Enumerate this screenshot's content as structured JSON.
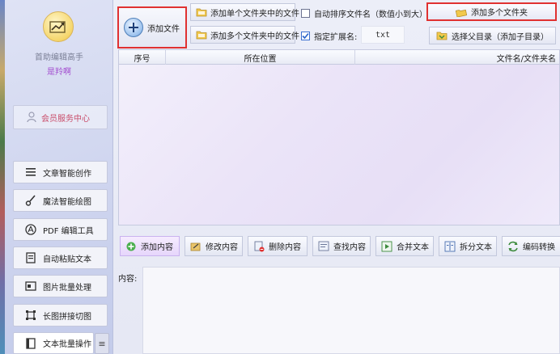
{
  "sidebar": {
    "app_name": "首助编辑高手",
    "user_name": "是羚啊",
    "member_center": "会员服务中心",
    "items": [
      {
        "label": "文章智能创作"
      },
      {
        "label": "魔法智能绘图"
      },
      {
        "label": "PDF 编辑工具"
      },
      {
        "label": "自动粘贴文本"
      },
      {
        "label": "图片批量处理"
      },
      {
        "label": "长图拼接切图"
      },
      {
        "label": "文本批量操作"
      }
    ],
    "more_label": "≡"
  },
  "toolbar": {
    "add_file": "添加文件",
    "add_single_folder_files": "添加单个文件夹中的文件",
    "add_multi_folder_files": "添加多个文件夹中的文件",
    "auto_sort_label": "自动排序文件名（数值小到大）",
    "auto_sort_checked": false,
    "ext_label": "指定扩展名:",
    "ext_checked": true,
    "ext_value": "txt",
    "add_multi_folders": "添加多个文件夹",
    "select_parent": "选择父目录（添加子目录）"
  },
  "table": {
    "columns": [
      "序号",
      "所在位置",
      "文件名/文件夹名"
    ]
  },
  "actions": {
    "add_content": "添加内容",
    "modify_content": "修改内容",
    "delete_content": "删除内容",
    "find_content": "查找内容",
    "merge_text": "合并文本",
    "split_text": "拆分文本",
    "encode_convert": "编码转换"
  },
  "content": {
    "label": "内容:"
  },
  "colors": {
    "highlight_border": "#e03131",
    "member_text": "#c94d6a",
    "user_name": "#a24ccf"
  }
}
